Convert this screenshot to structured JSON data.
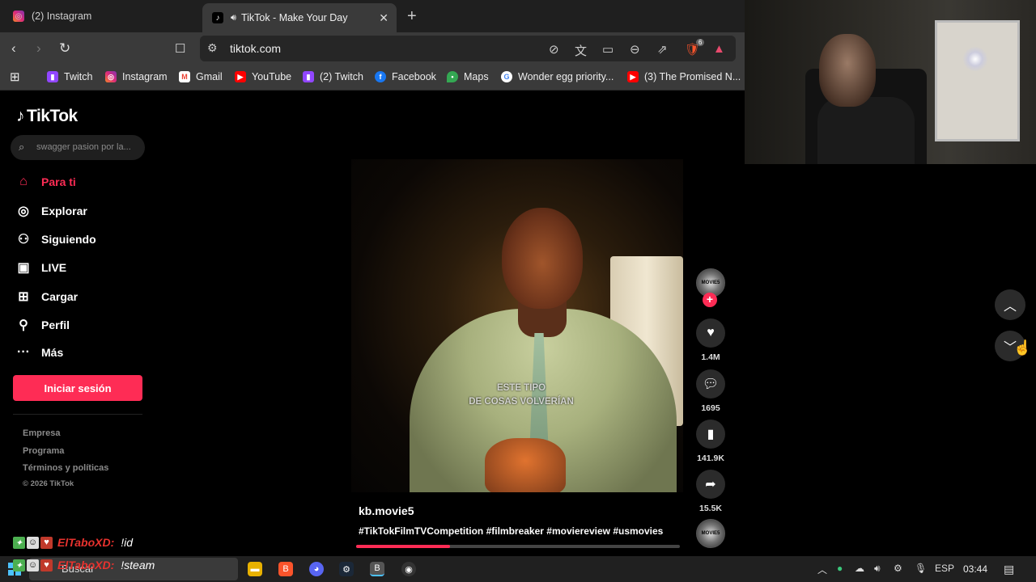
{
  "browser": {
    "tabs": [
      {
        "label": "(2) Instagram"
      },
      {
        "label": "TikTok - Make Your Day"
      }
    ],
    "url": "tiktok.com",
    "bookmarks": [
      "Twitch",
      "Instagram",
      "Gmail",
      "YouTube",
      "(2) Twitch",
      "Facebook",
      "Maps",
      "Wonder egg priority...",
      "(3) The Promised N..."
    ],
    "brave_badge": "6"
  },
  "tiktok": {
    "logo": "TikTok",
    "search_placeholder": "swagger pasion por la...",
    "menu": [
      {
        "label": "Para ti",
        "icon": "home-icon",
        "active": true
      },
      {
        "label": "Explorar",
        "icon": "compass-icon"
      },
      {
        "label": "Siguiendo",
        "icon": "following-icon"
      },
      {
        "label": "LIVE",
        "icon": "live-icon"
      },
      {
        "label": "Cargar",
        "icon": "upload-icon"
      },
      {
        "label": "Perfil",
        "icon": "profile-icon"
      },
      {
        "label": "Más",
        "icon": "more-icon"
      }
    ],
    "login_label": "Iniciar sesión",
    "footer": [
      "Empresa",
      "Programa",
      "Términos y políticas",
      "© 2026 TikTok"
    ],
    "video": {
      "subtitle_line1": "ESTE TIPO",
      "subtitle_line2": "DE COSAS VOLVERÍAN",
      "author": "kb.movie5",
      "caption": "#TikTokFilmTVCompetition #filmbreaker #moviereview #usmovies",
      "progress": 0.29,
      "avatar_text": "MOVIE5",
      "likes": "1.4M",
      "comments": "1695",
      "saves": "141.9K",
      "shares": "15.5K"
    }
  },
  "chat": [
    {
      "user": "ElTaboXD:",
      "message": "!id"
    },
    {
      "user": "ElTaboXD:",
      "message": "!steam"
    }
  ],
  "taskbar": {
    "search_label": "Buscar",
    "language": "ESP",
    "time": "03:44"
  },
  "colors": {
    "tiktok_accent": "#fe2c55",
    "chat_username": "#e8322e",
    "windows_blue": "#4cc2ff"
  }
}
